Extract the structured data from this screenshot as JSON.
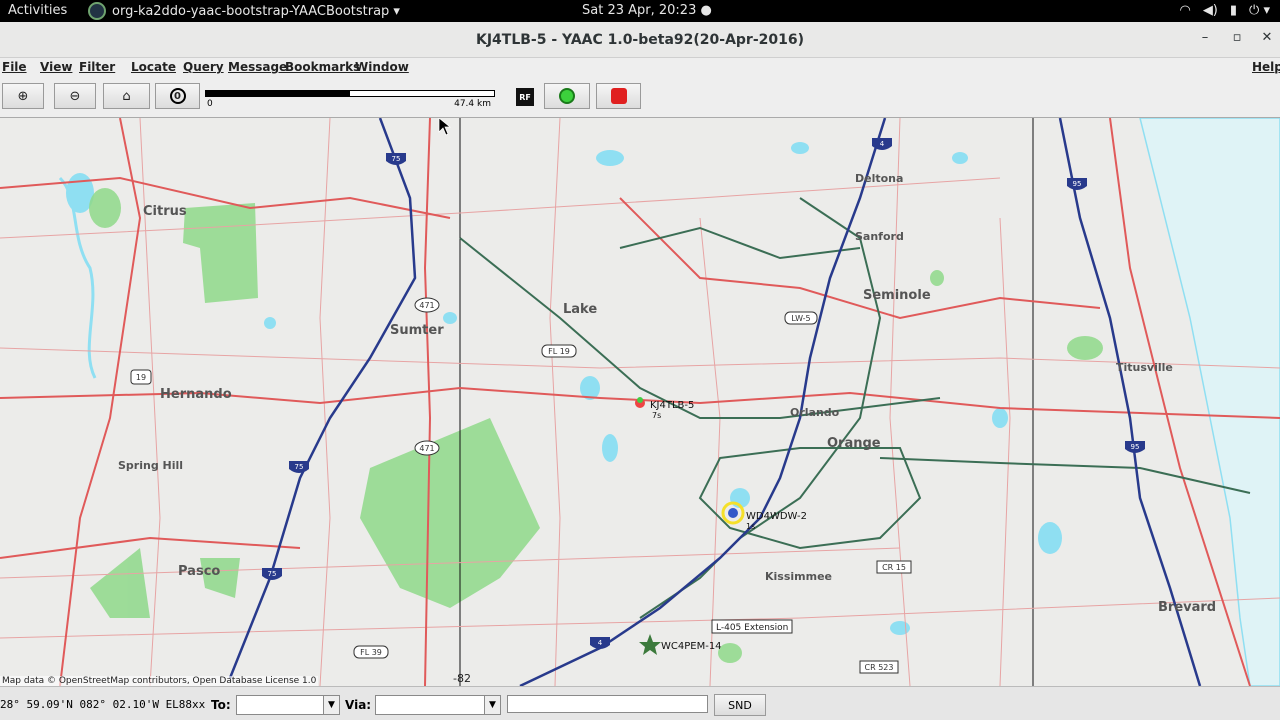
{
  "topbar": {
    "activities": "Activities",
    "app_name": "org-ka2ddo-yaac-bootstrap-YAACBootstrap ▾",
    "clock": "Sat 23 Apr, 20:23 ●",
    "tray": [
      "wifi-icon",
      "volume-icon",
      "battery-icon",
      "power-icon"
    ],
    "tray_glyphs": [
      "◠",
      "◀)",
      "▮",
      "⏻ ▾"
    ]
  },
  "window": {
    "title": "KJ4TLB-5 - YAAC 1.0-beta92(20-Apr-2016)",
    "minimize": "–",
    "maximize": "▫",
    "close": "✕"
  },
  "menu": [
    "File",
    "View",
    "Filter",
    "Locate",
    "Query",
    "Message",
    "Bookmarks",
    "Window"
  ],
  "help": "Help",
  "toolbar": {
    "zoom_in": "⊕",
    "zoom_out": "⊖",
    "home": "⌂",
    "reset": "0",
    "rf": "RF",
    "scale_start": "0",
    "scale_end": "47.4 km"
  },
  "map": {
    "counties": [
      "Citrus",
      "Sumter",
      "Lake",
      "Hernando",
      "Spring Hill",
      "Pasco",
      "Deltona",
      "Sanford",
      "Seminole",
      "Orlando",
      "Orange",
      "Kissimmee",
      "Titusville",
      "Brevard"
    ],
    "shields": [
      "75",
      "4",
      "95",
      "471",
      "FL 19",
      "19",
      "471",
      "75",
      "75",
      "4",
      "95",
      "LW-5",
      "CR 15",
      "CR 523",
      "FL 39"
    ],
    "stations": [
      {
        "call": "KJ4TLB-5",
        "sub": "7s"
      },
      {
        "call": "WD4WDW-2",
        "sub": "1s"
      },
      {
        "call": "WC4PEM-14",
        "sub": ""
      }
    ],
    "label_box": "L-405 Extension",
    "grid_number": "-82",
    "attribution": "Map data © OpenStreetMap contributors, Open Database License 1.0"
  },
  "status": {
    "coord": "28° 59.09'N 082° 02.10'W EL88xx",
    "to_label": "To:",
    "via_label": "Via:",
    "send_label": "SND",
    "arrow": "▼"
  },
  "colors": {
    "land": "#ececea",
    "water": "#8fdff2",
    "park": "#8fd98a",
    "interstate": "#283a8c",
    "highway": "#e05a5a",
    "rail": "#3b6e55"
  }
}
